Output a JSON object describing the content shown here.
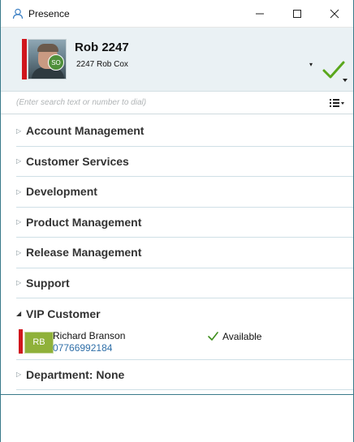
{
  "window": {
    "title": "Presence",
    "icons": {
      "app": "person-outline-icon",
      "minimize": "minimize-icon",
      "maximize": "maximize-icon",
      "close": "close-icon"
    },
    "minimize_glyph": "—",
    "maximize_glyph": "☐",
    "close_glyph": "✕"
  },
  "current_user": {
    "name": "Rob 2247",
    "extension_selected": "2247 Rob Cox",
    "avatar_badge": "SO",
    "status_color": "#d0161d",
    "availability_icon": "green-check-icon",
    "accent_color": "#5aa71c"
  },
  "search": {
    "placeholder": "(Enter search text or number to dial)",
    "value": ""
  },
  "groups": [
    {
      "label": "Account Management",
      "expanded": false
    },
    {
      "label": "Customer Services",
      "expanded": false
    },
    {
      "label": "Development",
      "expanded": false
    },
    {
      "label": "Product Management",
      "expanded": false
    },
    {
      "label": "Release Management",
      "expanded": false
    },
    {
      "label": "Support",
      "expanded": false
    },
    {
      "label": "VIP Customer",
      "expanded": true
    },
    {
      "label": "Department: None",
      "expanded": false
    }
  ],
  "vip_contacts": [
    {
      "initials": "RB",
      "name": "Richard Branson",
      "number": "07766992184",
      "status": "Available",
      "status_icon": "green-check-icon"
    }
  ],
  "glyphs": {
    "collapsed_arrow": "▷",
    "expanded_arrow": "◢",
    "dropdown_arrow": "▾"
  }
}
